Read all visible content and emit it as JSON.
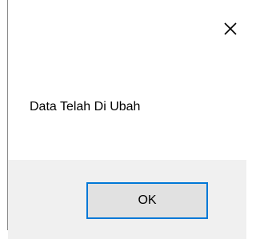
{
  "dialog": {
    "message": "Data Telah Di Ubah",
    "ok_label": "OK",
    "close_icon": "close-icon"
  },
  "colors": {
    "focus_border": "#0078d7",
    "button_face": "#e1e1e1",
    "footer_background": "#f0f0f0",
    "window_border": "#8a8a8a"
  }
}
